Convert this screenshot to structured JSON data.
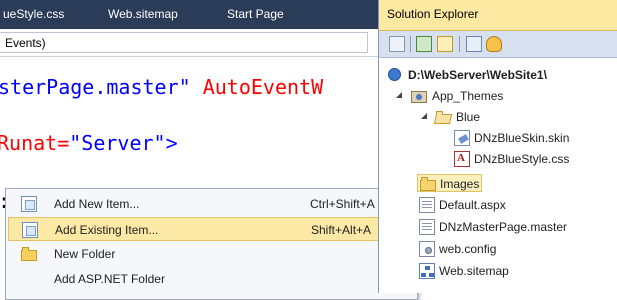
{
  "tabs": [
    {
      "label": "ueStyle.css"
    },
    {
      "label": "Web.sitemap"
    },
    {
      "label": "Start Page"
    }
  ],
  "nav": {
    "member_dropdown": "Events)"
  },
  "code_lines": {
    "line1": {
      "tag_attr": "sterPage.master\"",
      "attr2": " AutoEventW"
    },
    "line2": {
      "attr": "Runat=",
      "value": "\"Server\">"
    },
    "line3": {
      "fragment": ":"
    }
  },
  "context_menu": {
    "items": [
      {
        "label": "Add New Item...",
        "shortcut": "Ctrl+Shift+A",
        "icon": "new-item-icon"
      },
      {
        "label": "Add Existing Item...",
        "shortcut": "Shift+Alt+A",
        "icon": "existing-item-icon",
        "highlighted": true
      },
      {
        "label": "New Folder",
        "shortcut": "",
        "icon": "folder-icon"
      },
      {
        "label": "Add ASP.NET Folder",
        "shortcut": "",
        "icon": "",
        "has_submenu": true
      }
    ]
  },
  "solution_explorer": {
    "title": "Solution Explorer",
    "toolbar_icons": [
      "properties-icon",
      "refresh-icon",
      "show-all-files-icon",
      "view-code-icon",
      "copy-website-icon"
    ],
    "tree": [
      {
        "label": "D:\\WebServer\\WebSite1\\",
        "icon": "website-icon"
      },
      {
        "label": "App_Themes",
        "icon": "themes-folder-icon",
        "expanded": true
      },
      {
        "label": "Blue",
        "icon": "open-folder-icon",
        "expanded": true
      },
      {
        "label": "DNzBlueSkin.skin",
        "icon": "skin-file-icon"
      },
      {
        "label": "DNzBlueStyle.css",
        "icon": "css-file-icon"
      },
      {
        "label": "Images",
        "icon": "folder-icon",
        "selected": true
      },
      {
        "label": "Default.aspx",
        "icon": "aspx-file-icon"
      },
      {
        "label": "DNzMasterPage.master",
        "icon": "master-file-icon"
      },
      {
        "label": "web.config",
        "icon": "config-file-icon"
      },
      {
        "label": "Web.sitemap",
        "icon": "sitemap-file-icon"
      }
    ]
  },
  "colors": {
    "tab_bar": "#2b3c59",
    "se_title_bg": "#fde9a2",
    "menu_highlight": "#fce9a6",
    "code_tag": "#a31515",
    "code_value": "#0000ff",
    "code_attr": "#ff0000"
  }
}
